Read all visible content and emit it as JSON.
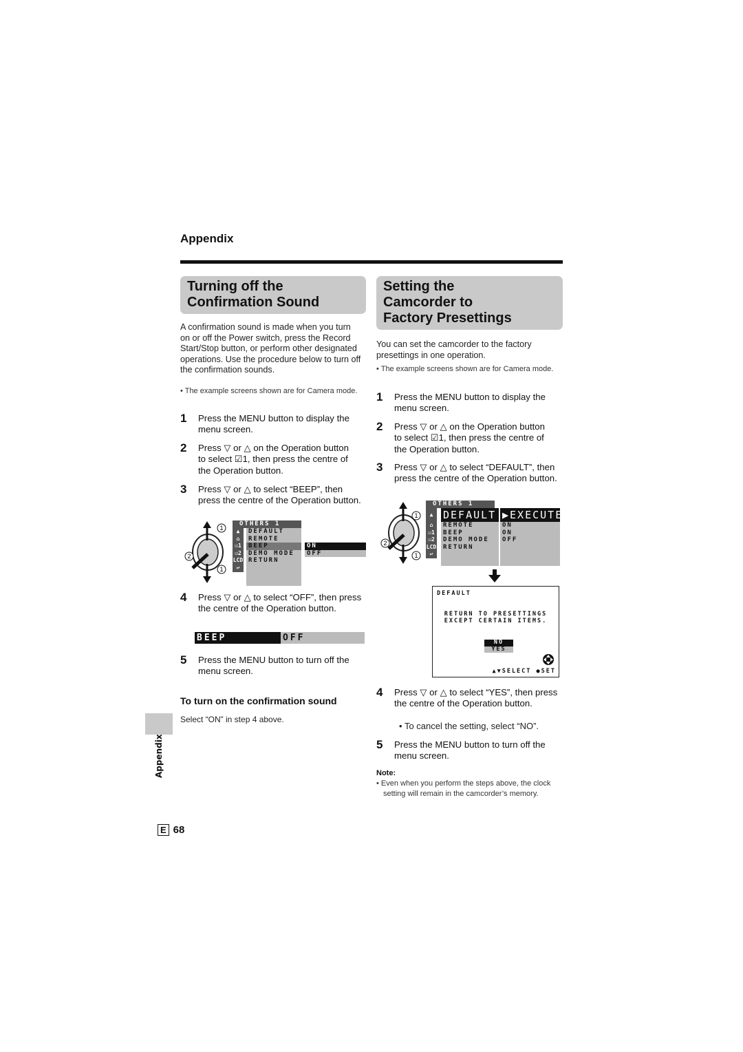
{
  "section": "Appendix",
  "left": {
    "title_lines": [
      "Turning off the",
      "Confirmation Sound"
    ],
    "intro": "A confirmation sound is made when you turn on or off the Power switch, press the Record Start/Stop button, or perform other designated operations. Use the procedure below to turn off the confirmation sounds.",
    "bullet": "The example screens shown are for Camera mode.",
    "steps": [
      {
        "n": "1",
        "text": "Press the MENU button to display the menu screen."
      },
      {
        "n": "2",
        "text": "Press ▽ or △ on the Operation button to select ☑1, then press the centre of the Operation button."
      },
      {
        "n": "3",
        "text": "Press ▽ or △ to select “BEEP”, then press the centre of the Operation button."
      },
      {
        "n": "4",
        "text": "Press ▽ or △ to select “OFF”, then press the centre of the Operation button."
      },
      {
        "n": "5",
        "text": "Press the MENU button to turn off the menu screen."
      }
    ],
    "menu": {
      "header": "OTHERS 1",
      "items": [
        "DEFAULT",
        "REMOTE",
        "BEEP",
        "DEMO MODE",
        "RETURN"
      ],
      "options": [
        "ON",
        "OFF"
      ],
      "icons": [
        "▲",
        "⌂",
        "☑1",
        "☑2",
        "LCD",
        "↩"
      ]
    },
    "callouts": [
      "1",
      "2",
      "1"
    ],
    "beep_bar": {
      "label": "BEEP",
      "value": "OFF"
    },
    "subheading": "To turn on the confirmation sound",
    "subtext": "Select “ON” in step 4 above."
  },
  "right": {
    "title_lines": [
      "Setting the",
      "Camcorder to",
      "Factory Presettings"
    ],
    "intro": "You can set the camcorder to the factory presettings in one operation.",
    "bullet": "The example screens shown are for Camera mode.",
    "steps": [
      {
        "n": "1",
        "text": "Press the MENU button to display the menu screen."
      },
      {
        "n": "2",
        "text": "Press ▽ or △ on the Operation button to select ☑1, then press the centre of the Operation button."
      },
      {
        "n": "3",
        "text": "Press ▽ or △ to select “DEFAULT”, then press the centre of the Operation button."
      },
      {
        "n": "4",
        "text": "Press ▽ or △ to select “YES”, then press the centre of the Operation button."
      },
      {
        "n": "5",
        "text": "Press the MENU button to turn off the menu screen."
      }
    ],
    "step4_bullet": "To cancel the setting, select “NO”.",
    "menu": {
      "header": "OTHERS 1",
      "items": [
        "DEFAULT",
        "REMOTE",
        "BEEP",
        "DEMO MODE",
        "RETURN"
      ],
      "values": [
        "▶EXECUTE",
        "ON",
        "ON",
        "OFF"
      ],
      "icons": [
        "▲",
        "⌂",
        "☑1",
        "☑2",
        "LCD",
        "↩"
      ]
    },
    "callouts": [
      "1",
      "2",
      "1"
    ],
    "default_screen": {
      "title": "DEFAULT",
      "message_lines": [
        "RETURN TO PRESETTINGS",
        "EXCEPT CERTAIN ITEMS."
      ],
      "options": [
        "NO",
        "YES"
      ],
      "footer": "▲▼SELECT ●SET"
    },
    "note_label": "Note:",
    "note": "Even when you perform the steps above, the clock setting will remain in the camcorder’s memory."
  },
  "side_tab": "Appendix",
  "footer": {
    "lang": "E",
    "page": "68"
  }
}
